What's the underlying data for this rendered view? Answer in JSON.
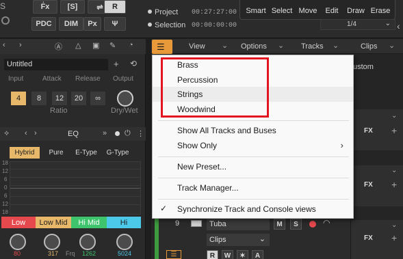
{
  "toolbar": {
    "buttons_row1": [
      "F̾x",
      "[S]",
      "",
      "R"
    ],
    "buttons_row2": [
      "PDC",
      "DIM",
      "Px",
      ""
    ],
    "transport": [
      {
        "label": "Project",
        "time": "00:27:27:00"
      },
      {
        "label": "Selection",
        "time": "00:00:00:00"
      }
    ],
    "tools": [
      "Smart",
      "Select",
      "Move",
      "Edit",
      "Draw",
      "Erase"
    ],
    "snap_value": "1/4"
  },
  "left_panel": {
    "preset_name": "Untitled",
    "compressor": {
      "params": [
        "Input",
        "Attack",
        "Release",
        "Output"
      ],
      "ratios": [
        "4",
        "8",
        "12",
        "20",
        "∞"
      ],
      "selected_ratio": "4",
      "ratio_label": "Ratio",
      "drywet_label": "Dry/Wet"
    },
    "eq": {
      "title": "EQ",
      "modes": [
        "Hybrid",
        "Pure",
        "E-Type",
        "G-Type"
      ],
      "selected_mode": "Hybrid",
      "grid_labels": [
        "18",
        "12",
        "6",
        "0",
        "6",
        "12",
        "18"
      ],
      "bands": [
        {
          "name": "Low",
          "color": "#e5484d",
          "value": "80",
          "value_color": "#e5484d"
        },
        {
          "name": "Low Mid",
          "color": "#e8b86a",
          "value": "317",
          "value_color": "#e8b86a"
        },
        {
          "name": "Hi Mid",
          "color": "#3ec46d",
          "value": "1262",
          "value_color": "#3ec46d"
        },
        {
          "name": "Hi",
          "color": "#4cc9e8",
          "value": "5024",
          "value_color": "#4cc9e8"
        }
      ],
      "freq_label": "Frq"
    }
  },
  "track_header": {
    "menus": [
      "View",
      "Options",
      "Tracks",
      "Clips"
    ],
    "custom_label": "ustom"
  },
  "dropdown": {
    "groups": [
      "Brass",
      "Percussion",
      "Strings",
      "Woodwind"
    ],
    "items": [
      {
        "label": "Show All Tracks and Buses"
      },
      {
        "label": "Show Only",
        "submenu": true
      },
      {
        "label": "New Preset..."
      },
      {
        "label": "Track Manager..."
      },
      {
        "label": "Synchronize Track and Console views",
        "checked": true
      }
    ]
  },
  "tracks": {
    "fx_label": "FX",
    "visible_track": {
      "number": "9",
      "name": "Tuba",
      "lane_mode": "Clips"
    },
    "track_buttons": [
      "M",
      "S"
    ],
    "bottom_buttons": [
      "R",
      "W",
      "✶",
      "A"
    ]
  },
  "colors": {
    "accent": "#e89a3a",
    "highlight_box": "#e3141f",
    "selected": "#e8b86a"
  }
}
